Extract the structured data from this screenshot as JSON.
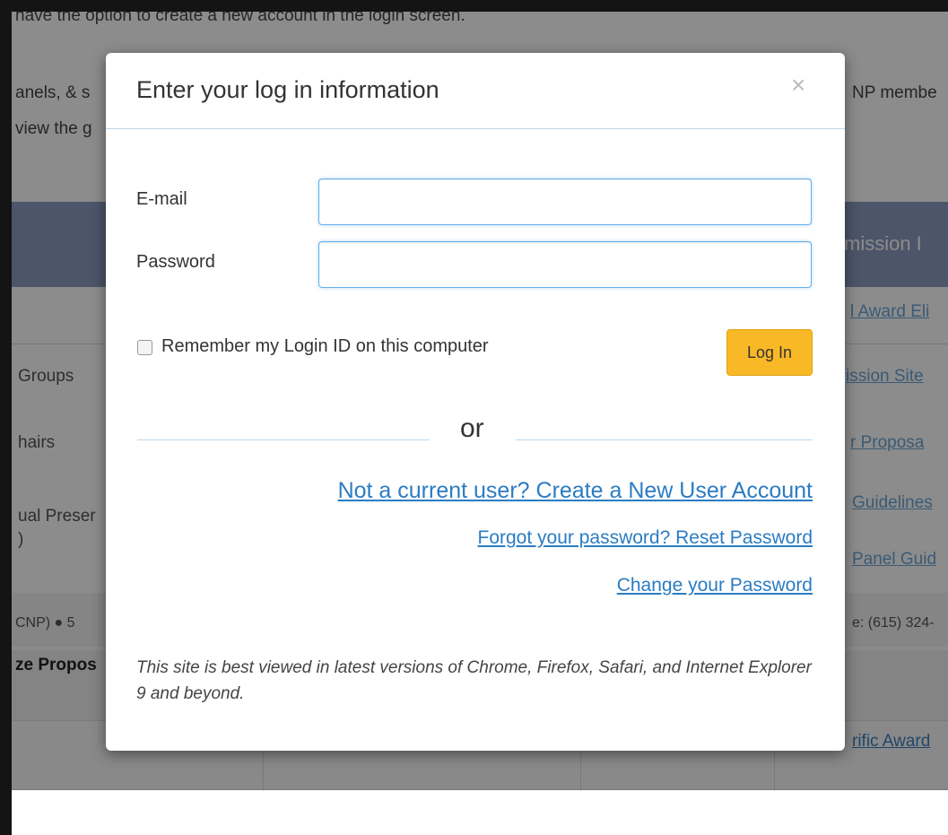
{
  "background": {
    "fragments": [
      "have the option to create a new account in the login screen.",
      "anels, & s",
      "view the g",
      "NP membe",
      "Groups",
      "hairs",
      "ual Preser",
      ")",
      "CNP) ●  5",
      "ze Propos",
      "e: (615) 324-"
    ],
    "header_text": "mission I",
    "links": [
      "l Award Eli",
      "ission Site",
      "r Proposa",
      "Guidelines",
      "Panel Guid",
      "rific Award"
    ]
  },
  "modal": {
    "title": "Enter your log in information",
    "close_label": "×",
    "email_label": "E-mail",
    "email_value": "",
    "password_label": "Password",
    "password_value": "",
    "remember_label": "Remember my Login ID on this computer",
    "remember_checked": false,
    "login_button": "Log In",
    "or_text": "or",
    "create_account_link": "Not a current user? Create a New User Account",
    "reset_password_link": "Forgot your password? Reset Password",
    "change_password_link": "Change your Password",
    "note": "This site is best viewed in latest versions of Chrome, Firefox, Safari, and Internet Explorer 9 and beyond."
  },
  "colors": {
    "login_button": "#f9b826",
    "link": "#2b7cc2",
    "header_band": "#8b9bc0"
  }
}
